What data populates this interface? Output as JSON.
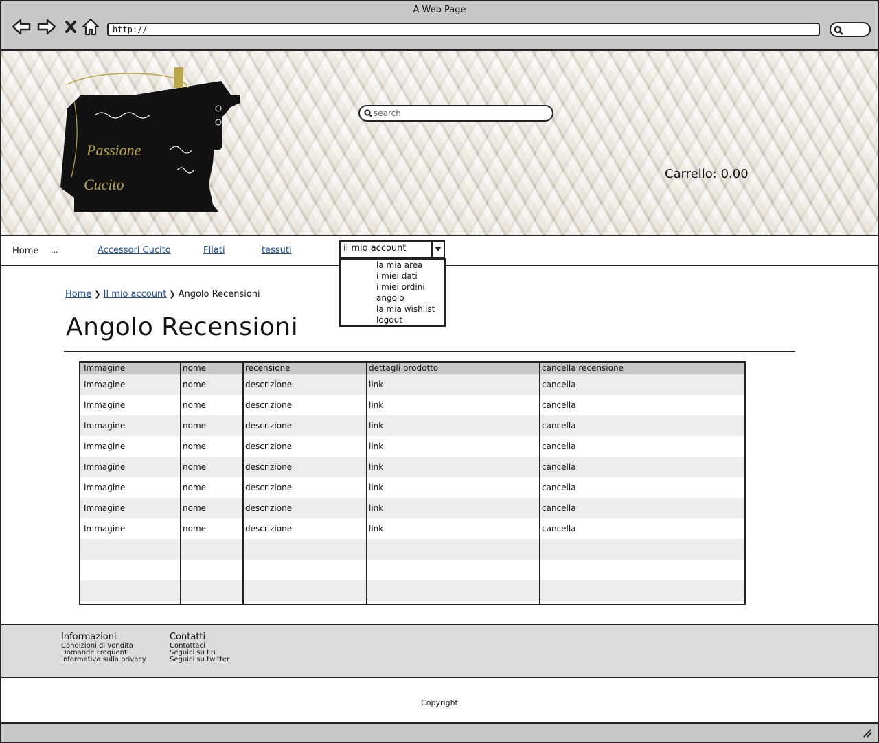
{
  "browser": {
    "title": "A Web Page",
    "url": "http://"
  },
  "header": {
    "search_placeholder": "search",
    "cart": "Carrello: 0.00",
    "logo_text": [
      "Passione",
      "Cucito"
    ]
  },
  "nav": {
    "home": "Home",
    "dots": "...",
    "links": [
      "Accessori Cucito",
      "FIlati",
      "tessuti"
    ],
    "account_select": "il mio account",
    "account_menu": [
      "la mia area",
      "i miei dati",
      "i miei ordini",
      "angolo",
      "la mia wishlist",
      "logout"
    ]
  },
  "breadcrumb": {
    "home": "Home",
    "account": "Il mio account",
    "current": "Angolo Recensioni"
  },
  "page": {
    "title": "Angolo Recensioni"
  },
  "table": {
    "headers": [
      "Immagine",
      "nome",
      "recensione",
      "dettagli prodotto",
      "cancella recensione"
    ],
    "rows": [
      [
        "Immagine",
        "nome",
        "descrizione",
        "link",
        "cancella"
      ],
      [
        "Immagine",
        "nome",
        "descrizione",
        "link",
        "cancella"
      ],
      [
        "Immagine",
        "nome",
        "descrizione",
        "link",
        "cancella"
      ],
      [
        "Immagine",
        "nome",
        "descrizione",
        "link",
        "cancella"
      ],
      [
        "Immagine",
        "nome",
        "descrizione",
        "link",
        "cancella"
      ],
      [
        "Immagine",
        "nome",
        "descrizione",
        "link",
        "cancella"
      ],
      [
        "Immagine",
        "nome",
        "descrizione",
        "link",
        "cancella"
      ],
      [
        "Immagine",
        "nome",
        "descrizione",
        "link",
        "cancella"
      ]
    ],
    "empty_rows": 3
  },
  "footer": {
    "info_title": "Informazioni",
    "info_items": [
      "Condizioni di vendita",
      "Domande Frequenti",
      "Informativa sulla privacy"
    ],
    "contact_title": "Contatti",
    "contact_items": [
      "Contattaci",
      "Seguici su FB",
      "Seguici su twitter"
    ],
    "copyright": "Copyright"
  }
}
